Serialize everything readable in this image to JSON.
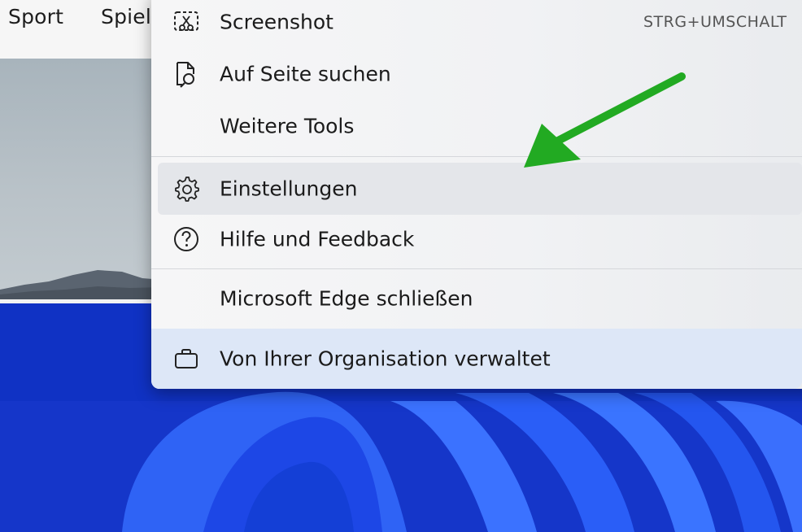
{
  "background_page": {
    "nav_items": [
      "Sport",
      "Spiel"
    ]
  },
  "menu": {
    "items": [
      {
        "label": "Screenshot",
        "icon": "screenshot-icon",
        "shortcut": "STRG+UMSCHALT"
      },
      {
        "label": "Auf Seite suchen",
        "icon": "find-on-page-icon"
      },
      {
        "label": "Weitere Tools",
        "icon": ""
      },
      {
        "label": "Einstellungen",
        "icon": "gear-icon",
        "highlighted": true
      },
      {
        "label": "Hilfe und Feedback",
        "icon": "help-icon"
      },
      {
        "label": "Microsoft Edge schließen",
        "icon": ""
      },
      {
        "label": "Von Ihrer Organisation verwaltet",
        "icon": "briefcase-icon"
      }
    ]
  },
  "annotation": {
    "arrow_color": "#22aa22",
    "points_to": "Einstellungen"
  },
  "colors": {
    "wallpaper_blue": "#1b3fd8",
    "managed_band": "#dde7f7",
    "hover": "#e4e6ea"
  }
}
